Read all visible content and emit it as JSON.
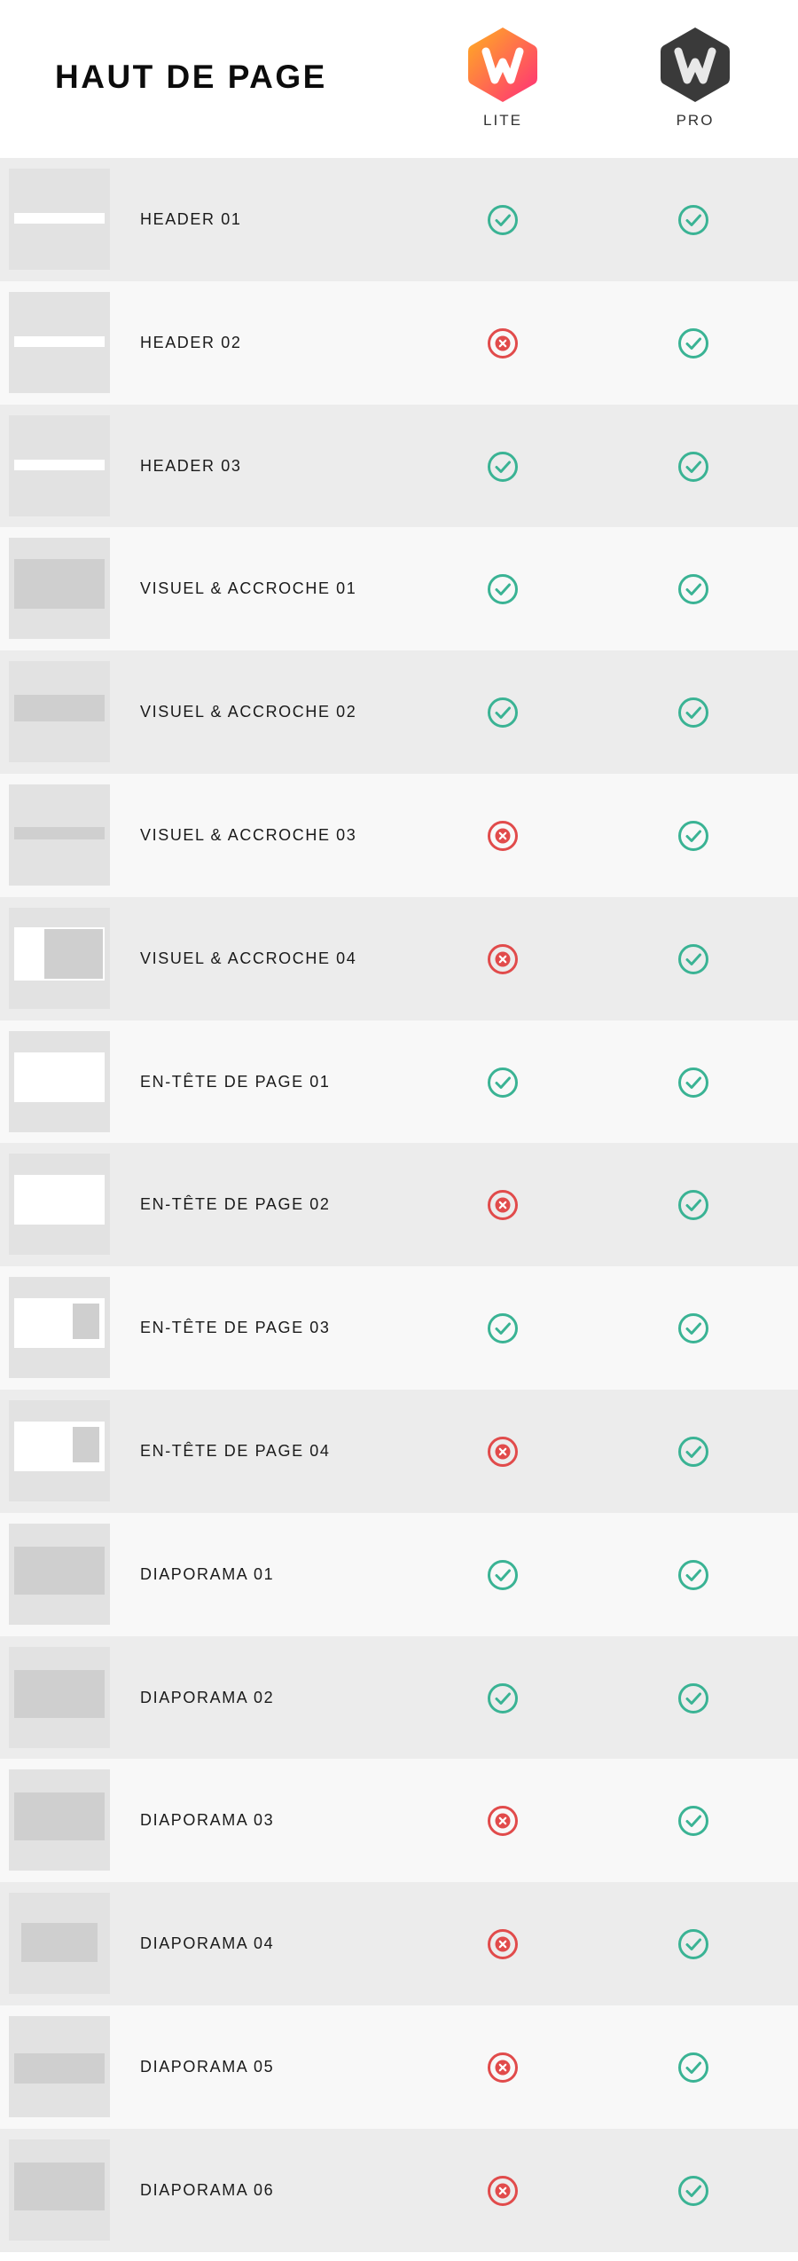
{
  "page": {
    "title": "HAUT DE PAGE",
    "colors": {
      "check": "#3ab394",
      "cross": "#e14b4b",
      "lite_gradient": [
        "#ffb020",
        "#ff2d7a"
      ],
      "pro": "#3a3a3a"
    }
  },
  "plans": [
    {
      "id": "lite",
      "label": "LITE",
      "icon": "w-logo-icon"
    },
    {
      "id": "pro",
      "label": "PRO",
      "icon": "w-logo-icon"
    }
  ],
  "rows": [
    {
      "label": "HEADER 01",
      "thumb": "header",
      "lite": true,
      "pro": true
    },
    {
      "label": "HEADER 02",
      "thumb": "header-logo",
      "lite": false,
      "pro": true
    },
    {
      "label": "HEADER 03",
      "thumb": "header-center",
      "lite": true,
      "pro": true
    },
    {
      "label": "VISUEL & ACCROCHE 01",
      "thumb": "visual-large",
      "lite": true,
      "pro": true
    },
    {
      "label": "VISUEL & ACCROCHE 02",
      "thumb": "visual-medium",
      "lite": true,
      "pro": true
    },
    {
      "label": "VISUEL & ACCROCHE 03",
      "thumb": "visual-thin",
      "lite": false,
      "pro": true
    },
    {
      "label": "VISUEL & ACCROCHE 04",
      "thumb": "visual-split",
      "lite": false,
      "pro": true
    },
    {
      "label": "EN-TÊTE DE PAGE 01",
      "thumb": "page-head-left",
      "lite": true,
      "pro": true
    },
    {
      "label": "EN-TÊTE DE PAGE 02",
      "thumb": "page-head-center",
      "lite": false,
      "pro": true
    },
    {
      "label": "EN-TÊTE DE PAGE 03",
      "thumb": "page-head-image",
      "lite": true,
      "pro": true
    },
    {
      "label": "EN-TÊTE DE PAGE 04",
      "thumb": "page-head-image-small",
      "lite": false,
      "pro": true
    },
    {
      "label": "DIAPORAMA 01",
      "thumb": "slider",
      "lite": true,
      "pro": true
    },
    {
      "label": "DIAPORAMA 02",
      "thumb": "slider-dots",
      "lite": true,
      "pro": true
    },
    {
      "label": "DIAPORAMA 03",
      "thumb": "slider-tabs",
      "lite": false,
      "pro": true
    },
    {
      "label": "DIAPORAMA 04",
      "thumb": "slider-box",
      "lite": false,
      "pro": true
    },
    {
      "label": "DIAPORAMA 05",
      "thumb": "slider-thin",
      "lite": false,
      "pro": true
    },
    {
      "label": "DIAPORAMA 06",
      "thumb": "slider-bottom",
      "lite": false,
      "pro": true
    }
  ]
}
